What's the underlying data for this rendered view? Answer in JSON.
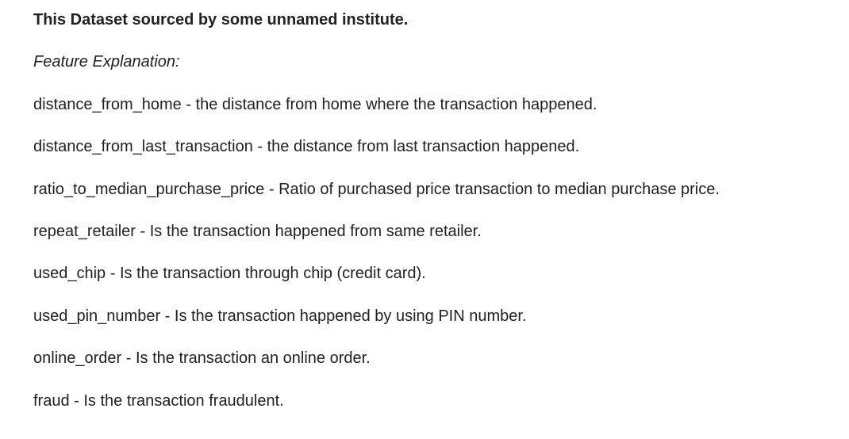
{
  "header": {
    "title": "This Dataset sourced by some unnamed institute.",
    "subtitle": "Feature Explanation:"
  },
  "features": [
    {
      "text": "distance_from_home - the distance from home where the transaction happened."
    },
    {
      "text": "distance_from_last_transaction - the distance from last transaction happened."
    },
    {
      "text": "ratio_to_median_purchase_price - Ratio of purchased price transaction to median purchase price."
    },
    {
      "text": "repeat_retailer - Is the transaction happened from same retailer."
    },
    {
      "text": "used_chip - Is the transaction through chip (credit card)."
    },
    {
      "text": "used_pin_number - Is the transaction happened by using PIN number."
    },
    {
      "text": "online_order - Is the transaction an online order."
    },
    {
      "text": "fraud - Is the transaction fraudulent."
    }
  ]
}
